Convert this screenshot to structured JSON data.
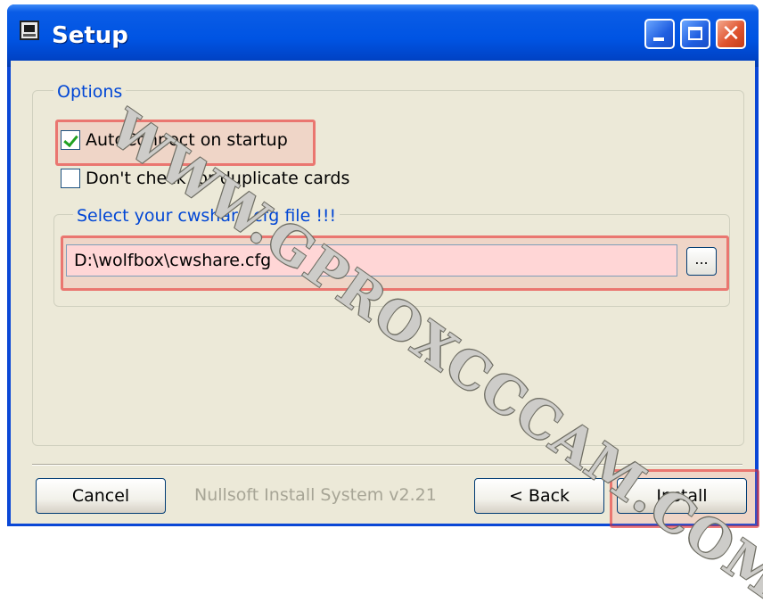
{
  "window": {
    "title": "Setup",
    "controls": {
      "minimize": "minimize-icon",
      "maximize": "maximize-icon",
      "close": "close-icon"
    }
  },
  "options": {
    "legend": "Options",
    "autoconnect": {
      "label": "AutoConnect on startup",
      "checked": true
    },
    "duplicate": {
      "label": "Don't check for duplicate cards",
      "checked": false
    },
    "file": {
      "legend": "Select your cwshare.cfg file !!!",
      "value": "D:\\wolfbox\\cwshare.cfg",
      "browse_label": "..."
    }
  },
  "footer": {
    "cancel_label": "Cancel",
    "branding": "Nullsoft Install System v2.21",
    "back_label": "< Back",
    "install_label": "Install"
  },
  "watermark": "WWW.GPROXCCCAM.COM",
  "colors": {
    "titlebar": "#0054e3",
    "dialog_bg": "#ece9d8",
    "legend_text": "#0046d5",
    "highlight": "#e62828"
  }
}
